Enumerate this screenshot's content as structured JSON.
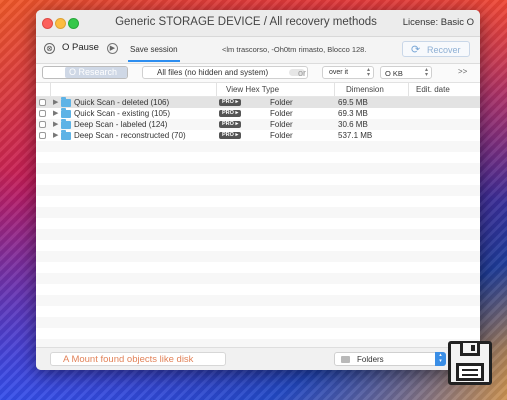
{
  "window": {
    "title": "Generic STORAGE DEVICE / All recovery methods",
    "license": "License: Basic O"
  },
  "toolbar": {
    "stop_glyph": "⊗",
    "pause_label": "O Pause",
    "pause_arrow_glyph": "▶",
    "save_session_label": "Save session",
    "status_text": "<lm trascorso, -Oh0tm rimasto, Blocco 128.",
    "recover_label": "Recover",
    "recover_icon_glyph": "⟳"
  },
  "filters": {
    "search_label": "O Research",
    "files_label": "All files (no hidden and system)",
    "or_label": "or",
    "over_label": "over it",
    "size_value": "O KB",
    "more_glyph": ">>"
  },
  "table": {
    "columns": [
      "View Hex Type",
      "Dimension",
      "Edit. date"
    ],
    "rows": [
      {
        "name": "Quick Scan - deleted (106)",
        "badge": "PRO ▸",
        "type": "Folder",
        "dimension": "69.5 MB"
      },
      {
        "name": "Quick Scan - existing (105)",
        "badge": "PRO ▸",
        "type": "Folder",
        "dimension": "69.3 MB"
      },
      {
        "name": "Deep Scan - labeled (124)",
        "badge": "PRO ▸",
        "type": "Folder",
        "dimension": "30.6 MB"
      },
      {
        "name": "Deep Scan - reconstructed (70)",
        "badge": "PRO ▸",
        "type": "Folder",
        "dimension": "537.1 MB"
      }
    ]
  },
  "bottom": {
    "mount_label": "A Mount found objects like disk",
    "view_mode": "Folders",
    "stepper_glyph": "▴▾"
  },
  "colors": {
    "accent": "#3a8ee6",
    "folder": "#5eb3e6",
    "mount_text": "#e2835a"
  },
  "icons": [
    "stop-icon",
    "play-arrow-icon",
    "recover-icon",
    "folder-icon",
    "disclosure-triangle-icon",
    "floppy-save-icon"
  ]
}
